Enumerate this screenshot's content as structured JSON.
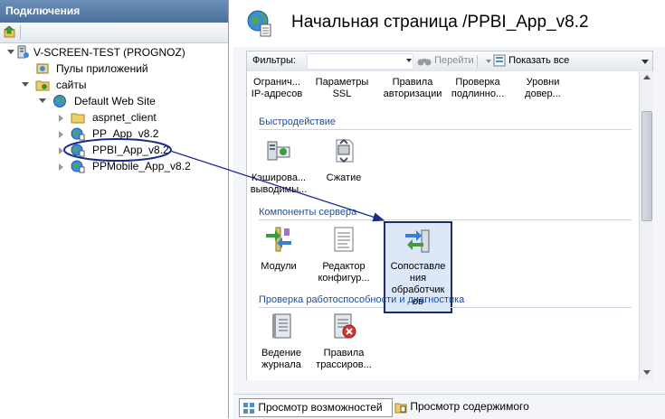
{
  "connections": {
    "header": "Подключения",
    "tree": [
      {
        "label": "V-SCREEN-TEST (PROGNOZ)",
        "level": 0,
        "expanded": true
      },
      {
        "label": "Пулы приложений",
        "level": 1,
        "expanded": null
      },
      {
        "label": "сайты",
        "level": 1,
        "expanded": true
      },
      {
        "label": "Default Web Site",
        "level": 2,
        "expanded": true
      },
      {
        "label": "aspnet_client",
        "level": 3,
        "expanded": false
      },
      {
        "label": "PP_App_v8.2",
        "level": 3,
        "expanded": false
      },
      {
        "label": "PPBI_App_v8.2",
        "level": 3,
        "expanded": false,
        "selected": true
      },
      {
        "label": "PPMobile_App_v8.2",
        "level": 3,
        "expanded": false
      }
    ]
  },
  "page": {
    "title": "Начальная страница /PPBI_App_v8.2"
  },
  "filter_bar": {
    "label": "Фильтры:",
    "go_label": "Перейти",
    "show_all_label": "Показать все"
  },
  "features": {
    "top_row": [
      {
        "label": "Огранич...\nIP-адресов"
      },
      {
        "label": "Параметры\nSSL"
      },
      {
        "label": "Правила\nавторизации"
      },
      {
        "label": "Проверка\nподлинно..."
      },
      {
        "label": "Уровни\nдовер..."
      }
    ],
    "sections": [
      {
        "title": "Быстродействие",
        "items": [
          {
            "label": "Кэширова...\nвыводимы..."
          },
          {
            "label": "Сжатие"
          }
        ]
      },
      {
        "title": "Компоненты сервера",
        "items": [
          {
            "label": "Модули"
          },
          {
            "label": "Редактор\nконфигур..."
          },
          {
            "label": "Сопоставле\nния\nобработчик\nов",
            "selected": true
          }
        ]
      },
      {
        "title": "Проверка работоспособности и диагностика",
        "items": [
          {
            "label": "Ведение\nжурнала"
          },
          {
            "label": "Правила\nтрассиров..."
          }
        ]
      }
    ]
  },
  "bottom_tabs": [
    {
      "label": "Просмотр возможностей",
      "active": true
    },
    {
      "label": "Просмотр содержимого",
      "active": false
    }
  ],
  "colors": {
    "section_title": "#1e4d9a",
    "highlight_border": "#1c2a6e",
    "annotation": "#1a2d8a"
  }
}
